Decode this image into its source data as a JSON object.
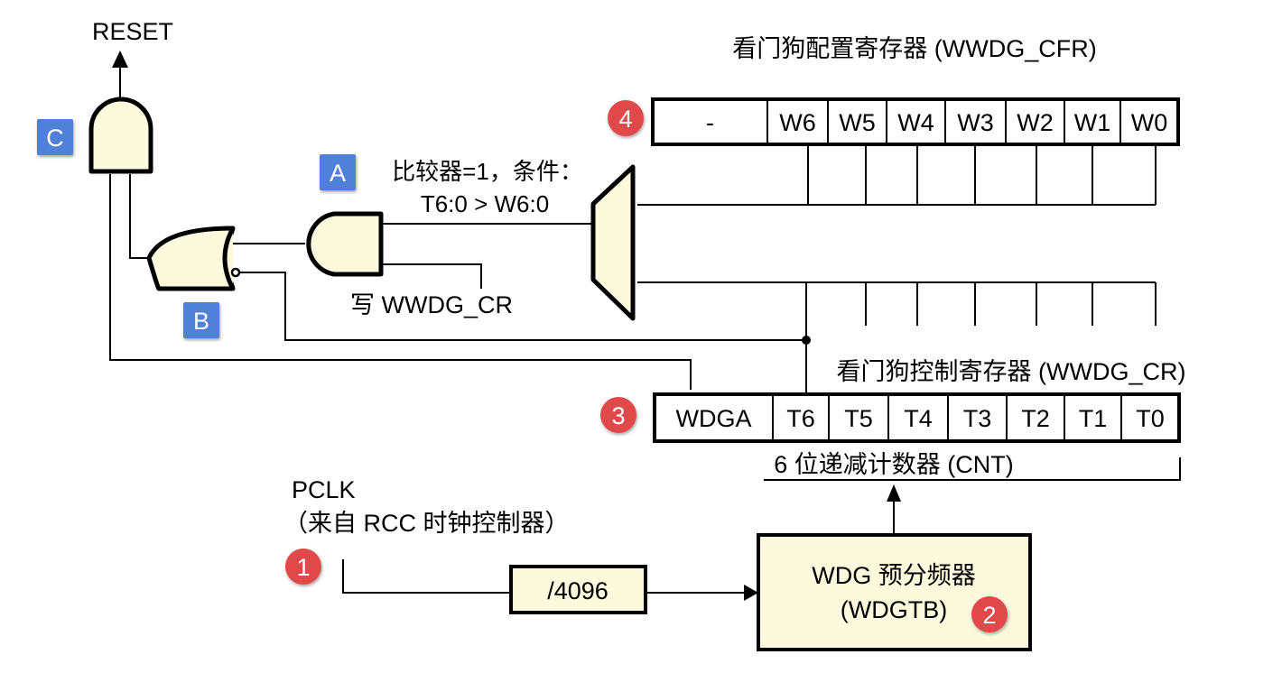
{
  "colors": {
    "gate_fill": "#fdf9dc",
    "tag_blue": "#5180d8",
    "badge_red": "#e04848",
    "line": "#000000"
  },
  "labels": {
    "reset": "RESET",
    "comparator_line1": "比较器=1，条件：",
    "comparator_line2": "T6:0 > W6:0",
    "write_cr": "写 WWDG_CR",
    "cfr_title": "看门狗配置寄存器 (WWDG_CFR)",
    "cr_title": "看门狗控制寄存器 (WWDG_CR)",
    "counter": "6 位递减计数器 (CNT)",
    "pclk": "PCLK",
    "pclk_source": "（来自 RCC 时钟控制器）",
    "divider": "/4096",
    "prescaler_line1": "WDG 预分频器",
    "prescaler_line2": "(WDGTB)"
  },
  "tags": {
    "a": "A",
    "b": "B",
    "c": "C"
  },
  "badges": {
    "one": "1",
    "two": "2",
    "three": "3",
    "four": "4"
  },
  "cfr_bits": [
    "-",
    "W6",
    "W5",
    "W4",
    "W3",
    "W2",
    "W1",
    "W0"
  ],
  "cr_bits": [
    "WDGA",
    "T6",
    "T5",
    "T4",
    "T3",
    "T2",
    "T1",
    "T0"
  ]
}
